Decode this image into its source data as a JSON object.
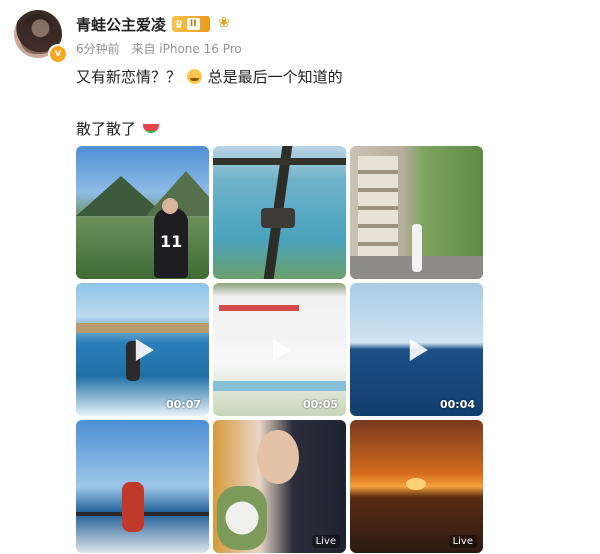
{
  "author": {
    "name": "青蛙公主爱凌",
    "level": "II",
    "verified_icon": "v-badge-icon",
    "crown_icon": "crown-icon",
    "sticker_icon": "sticker-icon"
  },
  "meta": {
    "time": "6分钟前",
    "source": "来自 iPhone 16 Pro"
  },
  "post": {
    "line1_a": "又有新恋情？？",
    "line1_b": "总是最后一个知道的",
    "line2": "散了散了",
    "emoji1": "grin-sweat-emoji",
    "emoji2": "watermelon-emoji"
  },
  "media": [
    {
      "kind": "photo",
      "desc_icon": "mountain-lake-photo"
    },
    {
      "kind": "photo",
      "desc_icon": "swing-photo"
    },
    {
      "kind": "photo",
      "desc_icon": "street-photo"
    },
    {
      "kind": "video",
      "duration": "00:07"
    },
    {
      "kind": "video",
      "duration": "00:05"
    },
    {
      "kind": "video",
      "duration": "00:04"
    },
    {
      "kind": "photo",
      "desc_icon": "boat-photo"
    },
    {
      "kind": "live",
      "badge": "Live"
    },
    {
      "kind": "live",
      "badge": "Live"
    }
  ]
}
